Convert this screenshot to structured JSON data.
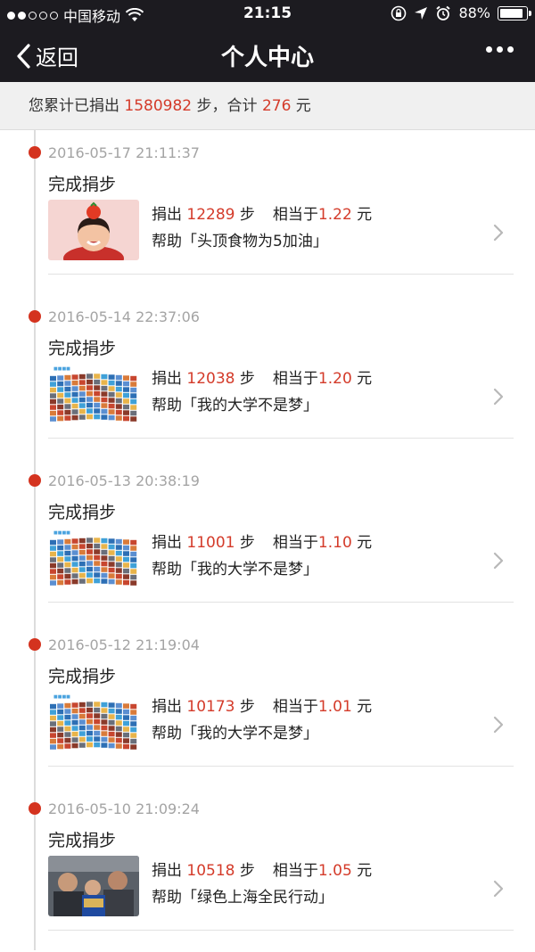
{
  "status": {
    "carrier": "中国移动",
    "time": "21:15",
    "battery": "88%",
    "battery_level": 0.88
  },
  "nav": {
    "back_label": "返回",
    "title": "个人中心"
  },
  "summary": {
    "prefix": "您累计已捐出",
    "steps": "1580982",
    "mid": "步，合计",
    "amount": "276",
    "suffix": "元"
  },
  "labels": {
    "done": "完成捐步",
    "donate": "捐出",
    "step_unit": "步",
    "equiv": "相当于",
    "yuan_unit": "元",
    "help_prefix": "帮助「",
    "help_suffix": "」"
  },
  "colors": {
    "accent_red": "#d43b2a",
    "navbar": "#1c1b20"
  },
  "entries": [
    {
      "date": "2016-05-17 21:11:37",
      "steps": "12289",
      "amount": "1.22",
      "project": "头顶食物为5加油",
      "thumb": "girl-with-tomato-photo"
    },
    {
      "date": "2016-05-14 22:37:06",
      "steps": "12038",
      "amount": "1.20",
      "project": "我的大学不是梦",
      "thumb": "photo-wall-image"
    },
    {
      "date": "2016-05-13 20:38:19",
      "steps": "11001",
      "amount": "1.10",
      "project": "我的大学不是梦",
      "thumb": "photo-wall-image"
    },
    {
      "date": "2016-05-12 21:19:04",
      "steps": "10173",
      "amount": "1.01",
      "project": "我的大学不是梦",
      "thumb": "photo-wall-image"
    },
    {
      "date": "2016-05-10 21:09:24",
      "steps": "10518",
      "amount": "1.05",
      "project": "绿色上海全民行动",
      "thumb": "crowd-photo"
    }
  ]
}
